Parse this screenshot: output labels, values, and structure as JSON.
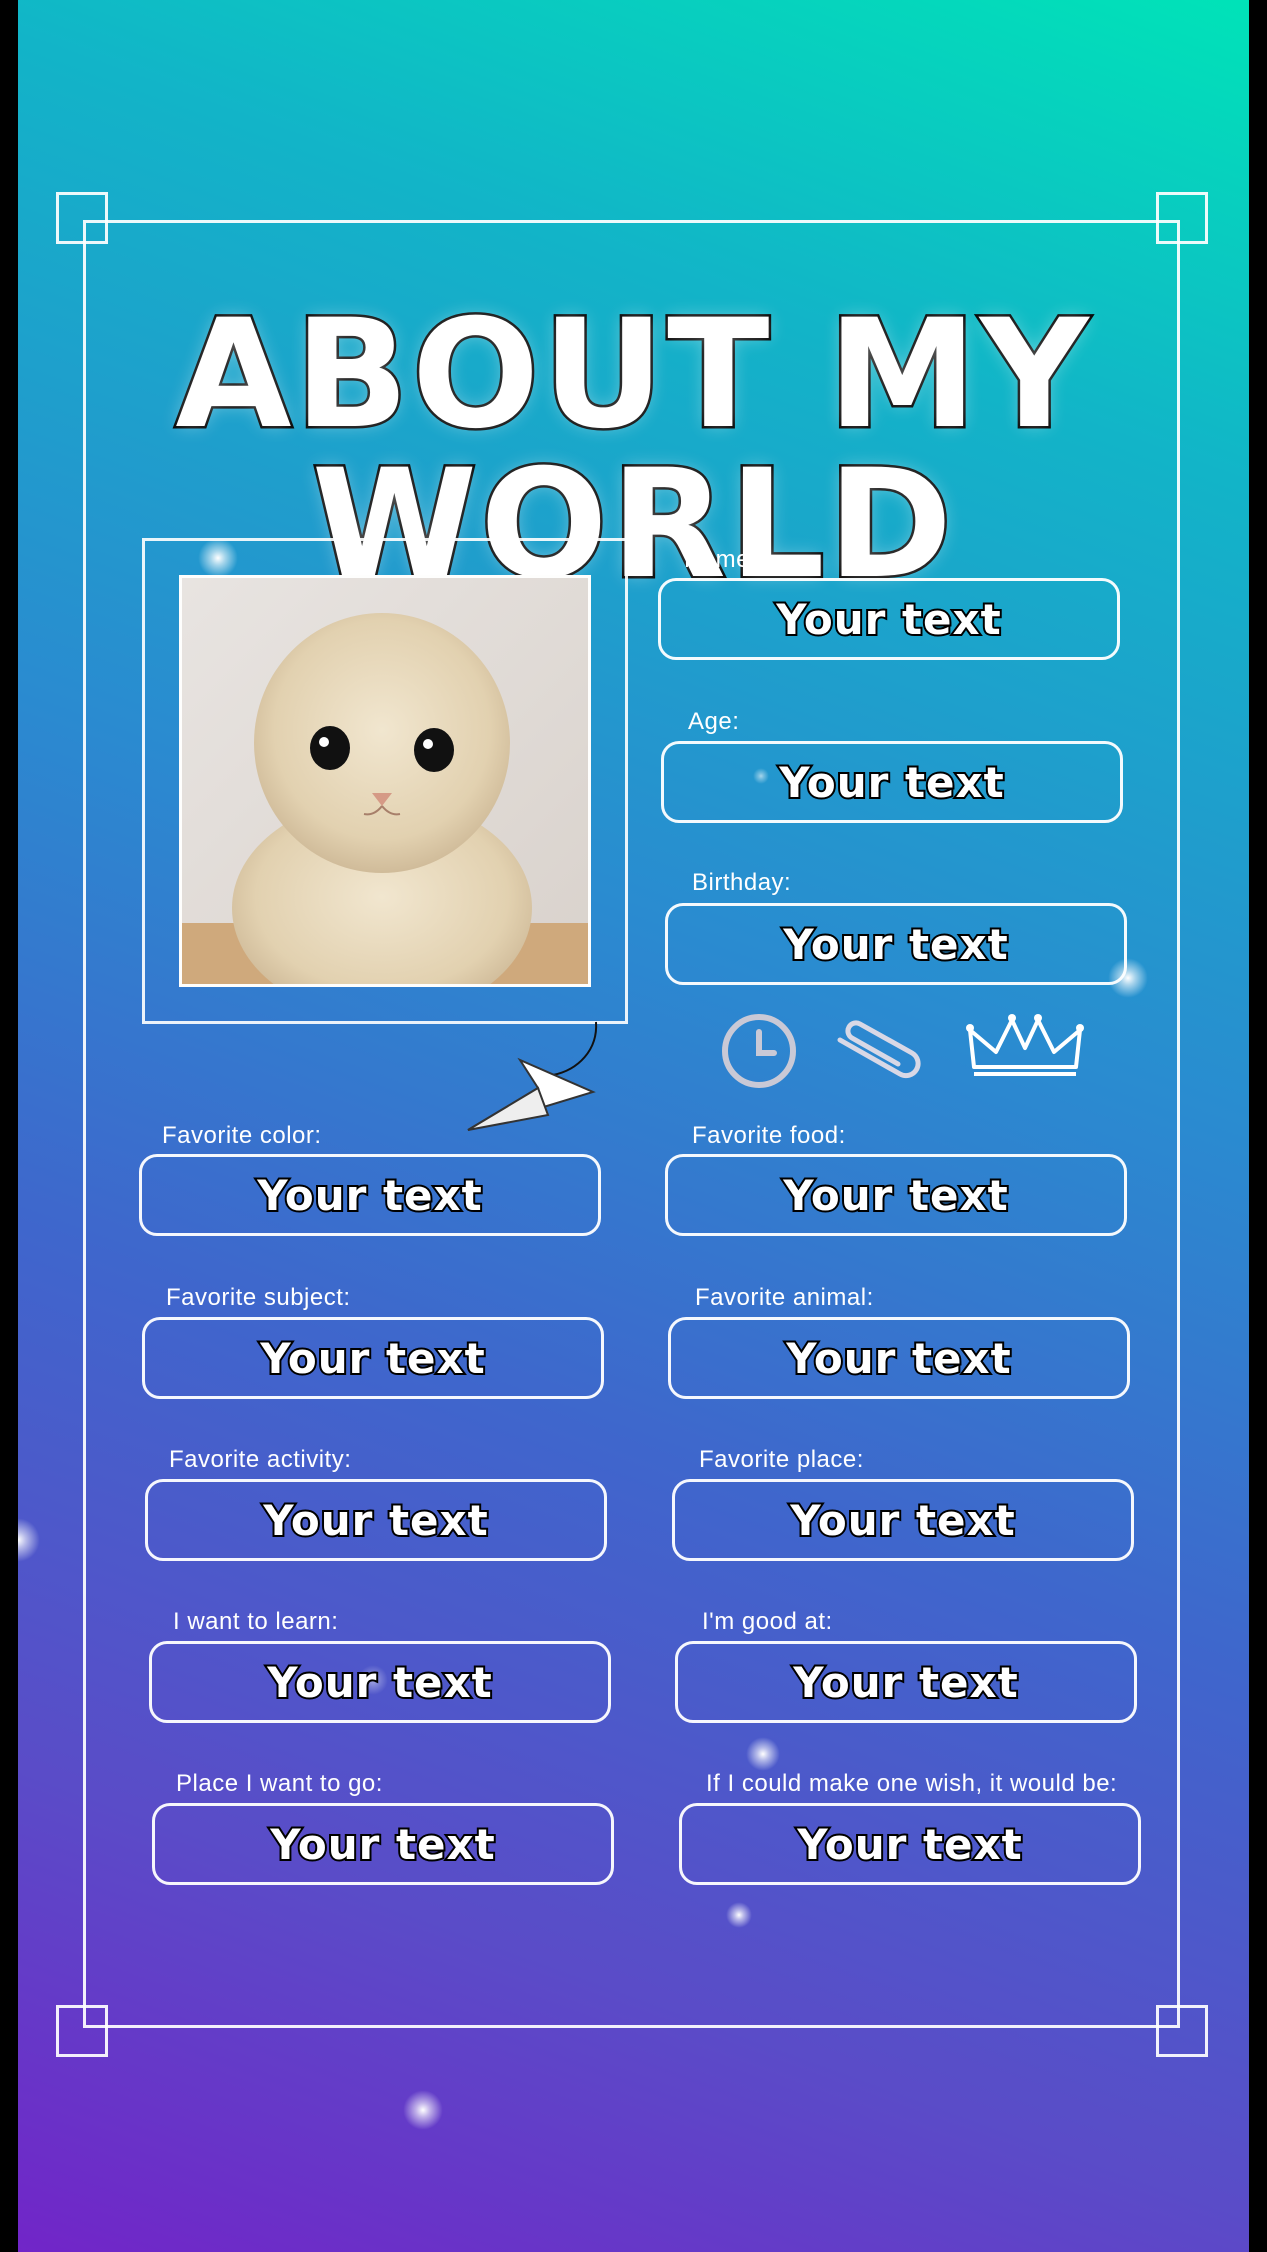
{
  "title": "ABOUT MY WORLD",
  "field_value": "Your text",
  "fields": {
    "name": {
      "label": "Name:",
      "value": "Your text"
    },
    "age": {
      "label": "Age:",
      "value": "Your text"
    },
    "birthday": {
      "label": "Birthday:",
      "value": "Your text"
    },
    "favorite_color": {
      "label": "Favorite color:",
      "value": "Your text"
    },
    "favorite_food": {
      "label": "Favorite food:",
      "value": "Your text"
    },
    "favorite_subject": {
      "label": "Favorite subject:",
      "value": "Your text"
    },
    "favorite_animal": {
      "label": "Favorite animal:",
      "value": "Your text"
    },
    "favorite_activity": {
      "label": "Favorite activity:",
      "value": "Your text"
    },
    "favorite_place": {
      "label": "Favorite place:",
      "value": "Your text"
    },
    "want_to_learn": {
      "label": "I want to learn:",
      "value": "Your text"
    },
    "good_at": {
      "label": "I'm good at:",
      "value": "Your text"
    },
    "place_to_go": {
      "label": "Place I want to go:",
      "value": "Your text"
    },
    "one_wish": {
      "label": "If I could make one wish, it would be:",
      "value": "Your text"
    }
  },
  "icons": [
    "clock-icon",
    "paperclip-icon",
    "crown-icon",
    "paper-plane-icon"
  ],
  "colors": {
    "gradient_top": "#00e3b8",
    "gradient_mid": "#2a8bd0",
    "gradient_bottom": "#7125c8",
    "outline": "#ffffff"
  }
}
